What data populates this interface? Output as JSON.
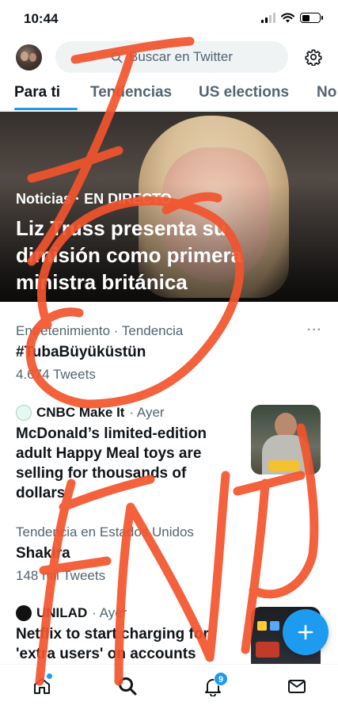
{
  "status_bar": {
    "time": "10:44",
    "battery_level": 0.45
  },
  "header": {
    "search_placeholder": "Buscar en Twitter",
    "icons": {
      "avatar": "user-avatar",
      "search": "search-icon",
      "settings": "gear-icon"
    }
  },
  "tabs": [
    {
      "label": "Para ti",
      "active": true
    },
    {
      "label": "Tendencias",
      "active": false
    },
    {
      "label": "US elections",
      "active": false
    },
    {
      "label": "No",
      "active": false
    }
  ],
  "hero": {
    "category": "Noticias",
    "live": "EN DIRECTO",
    "separator": "·",
    "title": "Liz Truss presenta su dimisión como primera ministra británica"
  },
  "trend": {
    "context": "Entretenimiento · Tendencia",
    "name": "#TubaBüyüküstün",
    "count": "4.674 Tweets",
    "more": "···"
  },
  "news_items": [
    {
      "source": "CNBC Make It",
      "time": "· Ayer",
      "title": "McDonald’s limited-edition adult Happy Meal toys are selling for thousands of dollars"
    },
    {
      "source": "UNILAD",
      "time": "· Ayer",
      "title": "Netflix to start charging for 'extra users' on accounts"
    }
  ],
  "trend2": {
    "context": "Tendencia en Estados Unidos",
    "name": "Shakira",
    "count": "148 mil Tweets"
  },
  "bottom_nav": {
    "notifications_badge": "9",
    "icons": [
      "home-icon",
      "search-icon",
      "bell-icon",
      "mail-icon"
    ]
  },
  "fab": {
    "icon": "plus-icon"
  },
  "annotation": {
    "stroke_color": "#f2542d"
  },
  "colors": {
    "accent": "#1d9bf0",
    "text": "#0f1419",
    "secondary": "#536471"
  }
}
